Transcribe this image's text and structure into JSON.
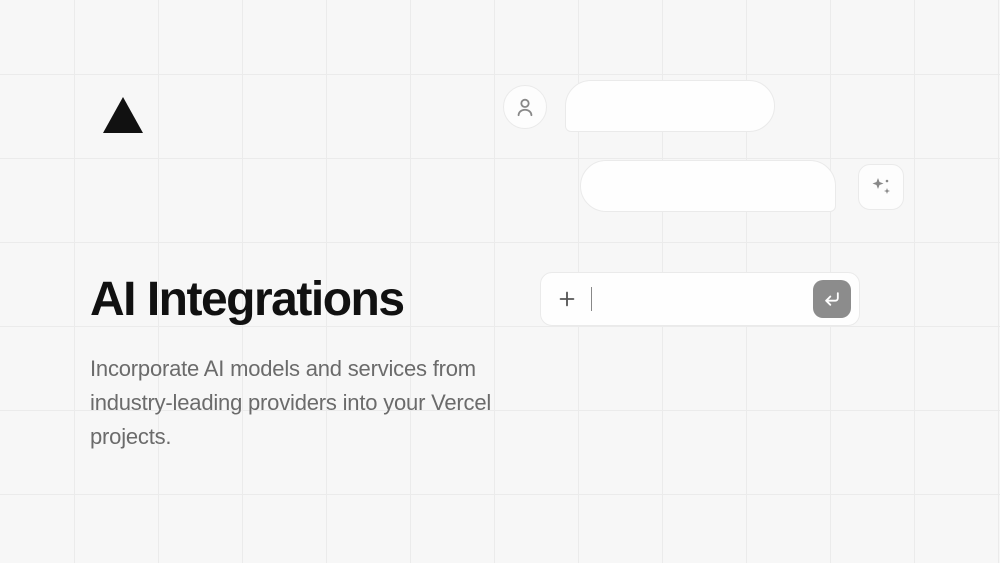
{
  "heading": "AI Integrations",
  "subtitle": "Incorporate AI models and services from industry-leading providers into your Vercel projects.",
  "input": {
    "value": "",
    "placeholder": ""
  },
  "colors": {
    "text_primary": "#111111",
    "text_secondary": "#6b6b6b",
    "bg": "#f7f7f7",
    "card": "#fefefe",
    "border": "#eaeaea",
    "send_button": "#8c8c8c"
  }
}
